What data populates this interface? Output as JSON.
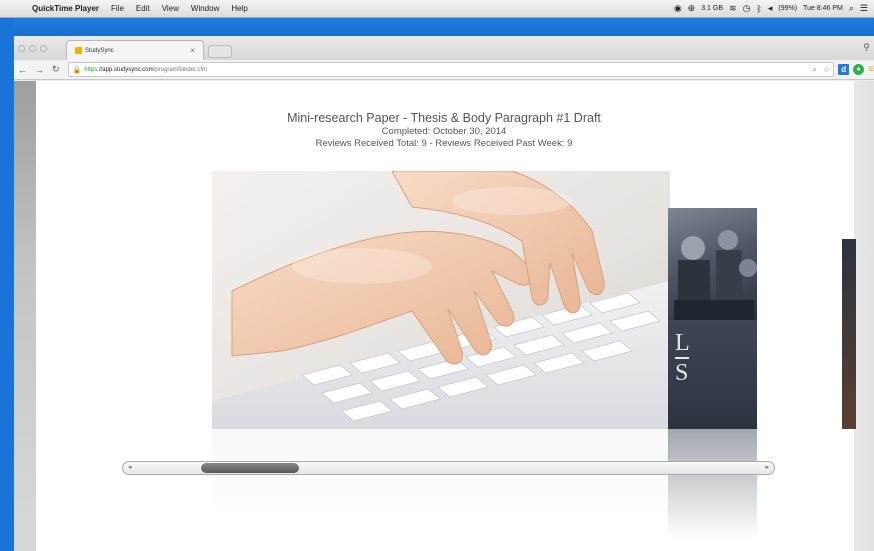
{
  "menubar": {
    "app_name": "QuickTime Player",
    "items": [
      "File",
      "Edit",
      "View",
      "Window",
      "Help"
    ],
    "status": {
      "storage": "3.1 GB",
      "battery": "(99%)",
      "clock": "Tue 8:46 PM"
    }
  },
  "browser": {
    "tab_title": "StudySync",
    "url_scheme": "https",
    "url_host": "://app.studysync.com",
    "url_path": "/program/binder.cfm",
    "extensions": {
      "d_label": "d"
    }
  },
  "page": {
    "title": "Mini-research Paper - Thesis & Body Paragraph #1 Draft",
    "completed": "Completed: October 30, 2014",
    "reviews": "Reviews Received Total: 9 - Reviews Received Past Week: 9"
  },
  "cover": {
    "letters": [
      "L",
      "S"
    ]
  },
  "scrollbar": {
    "thumb_start": 0.12,
    "thumb_size": 0.15
  },
  "colors": {
    "desktop_blue": "#1a73d8",
    "url_green": "#2a9d2a"
  }
}
